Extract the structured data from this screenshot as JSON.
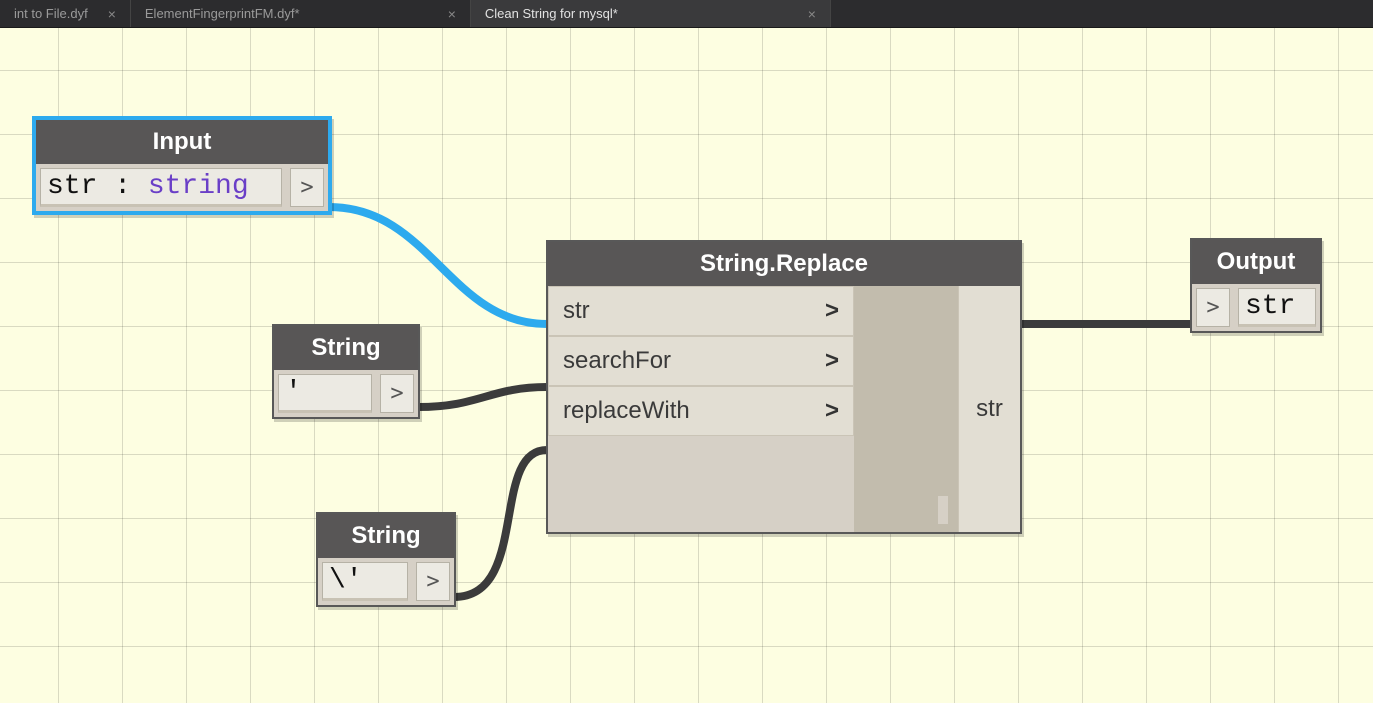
{
  "tabs": [
    {
      "label": "int to File.dyf",
      "active": false
    },
    {
      "label": "ElementFingerprintFM.dyf*",
      "active": false
    },
    {
      "label": "Clean String for mysql*",
      "active": true
    }
  ],
  "nodes": {
    "input": {
      "title": "Input",
      "code_prefix": "str : ",
      "code_type": "string",
      "port": ">"
    },
    "string1": {
      "title": "String",
      "value": "'",
      "port": ">"
    },
    "string2": {
      "title": "String",
      "value": "\\'",
      "port": ">"
    },
    "replace": {
      "title": "String.Replace",
      "inputs": [
        {
          "label": "str",
          "chev": ">"
        },
        {
          "label": "searchFor",
          "chev": ">"
        },
        {
          "label": "replaceWith",
          "chev": ">"
        }
      ],
      "output": "str"
    },
    "output": {
      "title": "Output",
      "port": ">",
      "value": "str"
    }
  }
}
